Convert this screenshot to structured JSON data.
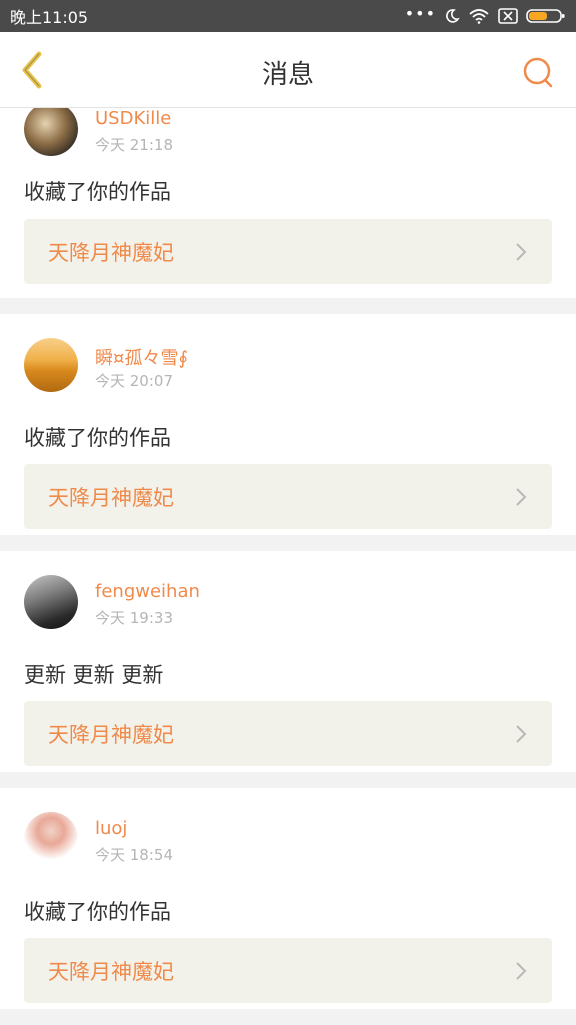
{
  "status_bar": {
    "time": "晚上11:05",
    "icons": [
      "more-dots-icon",
      "moon-icon",
      "wifi-icon",
      "sim-x-icon",
      "battery-icon"
    ],
    "battery_color": "#f5a623"
  },
  "header": {
    "title": "消息",
    "back_icon": "chevron-left-icon",
    "search_icon": "search-icon",
    "accent_color": "#f08a4b",
    "back_color": "#e9c44a"
  },
  "messages": [
    {
      "username": "USDKille",
      "time": "今天 21:18",
      "content": "收藏了你的作品",
      "work_title": "天降月神魔妃"
    },
    {
      "username": "瞬¤孤々雪∮",
      "time": "今天 20:07",
      "content": "收藏了你的作品",
      "work_title": "天降月神魔妃"
    },
    {
      "username": "fengweihan",
      "time": "今天 19:33",
      "content": "更新 更新 更新",
      "work_title": "天降月神魔妃"
    },
    {
      "username": "luoj",
      "time": "今天 18:54",
      "content": "收藏了你的作品",
      "work_title": "天降月神魔妃"
    }
  ]
}
